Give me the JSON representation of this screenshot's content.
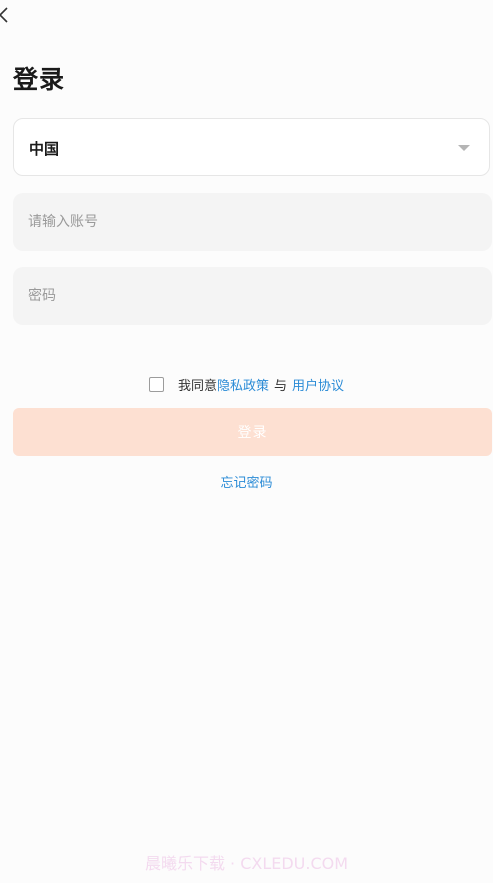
{
  "header": {
    "back_icon": "chevron-left-icon",
    "title": "登录"
  },
  "form": {
    "region": {
      "value": "中国",
      "caret_icon": "caret-down-icon"
    },
    "account": {
      "value": "",
      "placeholder": "请输入账号"
    },
    "password": {
      "value": "",
      "placeholder": "密码"
    },
    "agreement": {
      "checked": false,
      "prefix": "我同意",
      "privacy_link": "隐私政策",
      "separator": "与",
      "terms_link": "用户协议"
    },
    "login_label": "登录",
    "forgot_label": "忘记密码"
  },
  "watermark": "晨曦乐下载 · CXLEDU.COM",
  "colors": {
    "link": "#2a8bd6",
    "login_button_bg": "#fde0d2",
    "field_bg": "#f4f4f4",
    "page_bg": "#fcfcfc"
  }
}
